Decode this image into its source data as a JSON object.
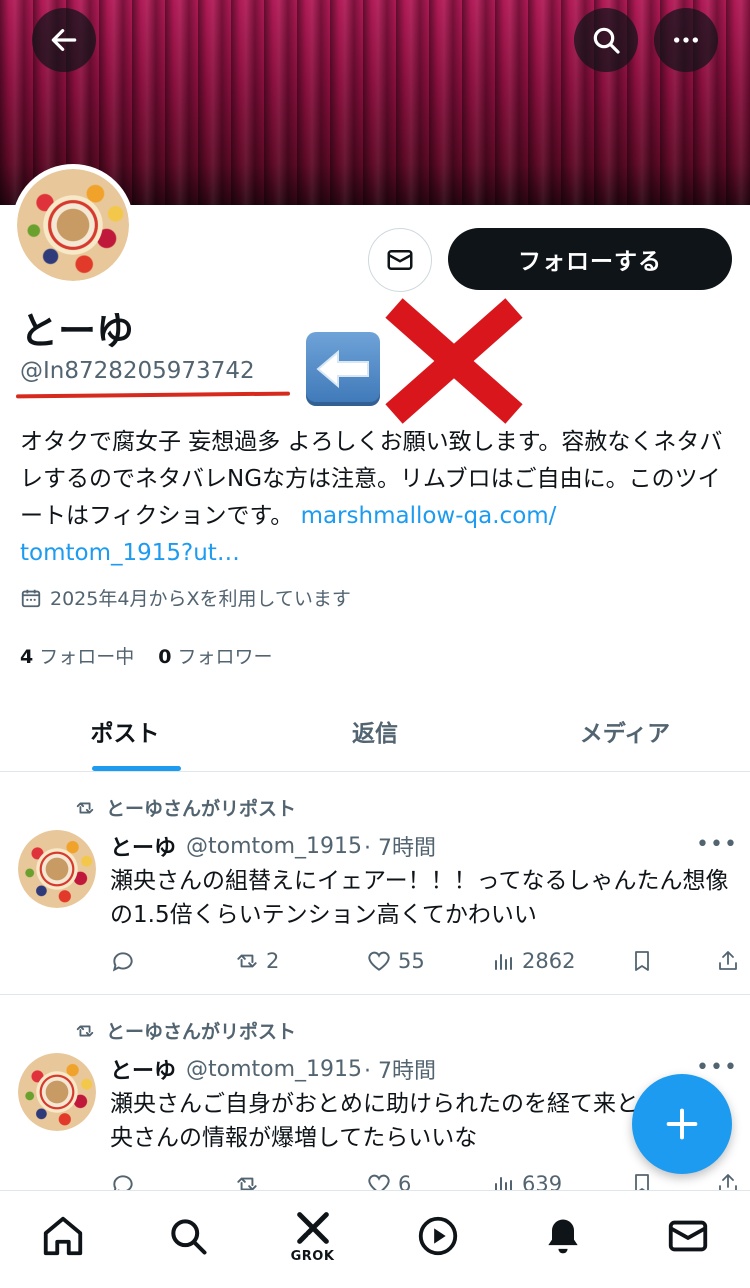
{
  "header": {
    "back_icon": "arrow-left-icon",
    "search_icon": "search-icon",
    "more_icon": "more-horizontal-icon"
  },
  "profile": {
    "name": "とーゆ",
    "handle": "@In8728205973742",
    "follow_label": "フォローする",
    "bio_text": "オタクで腐女子 妄想過多 よろしくお願い致します。容赦なくネタバレするのでネタバレNGな方は注意。リムブロはご自由に。このツイートはフィクションです。",
    "bio_link": "marshmallow-qa.com/ tomtom_1915?ut…",
    "joined": "2025年4月からXを利用しています",
    "following_count": "4",
    "following_label": "フォロー中",
    "followers_count": "0",
    "followers_label": "フォロワー"
  },
  "tabs": [
    {
      "label": "ポスト",
      "active": true
    },
    {
      "label": "返信",
      "active": false
    },
    {
      "label": "メディア",
      "active": false
    }
  ],
  "posts": [
    {
      "repost_label": "とーゆさんがリポスト",
      "author": "とーゆ",
      "handle": "@tomtom_1915",
      "time": "· 7時間",
      "more": "•••",
      "text": "瀬央さんの組替えにイェアー！！！ってなるしゃんたん想像の1.5倍くらいテンション高くてかわいい",
      "reposts": "2",
      "likes": "55",
      "views": "2862"
    },
    {
      "repost_label": "とーゆさんがリポスト",
      "author": "とーゆ",
      "handle": "@tomtom_1915",
      "time": "· 7時間",
      "more": "•••",
      "text": "瀬央さんご自身がおとめに助けられたのを経て来とめは瀬央さんの情報が爆増してたらいいな",
      "reposts": "",
      "likes": "6",
      "views": "639"
    }
  ],
  "bottom_nav": [
    {
      "icon": "home-icon"
    },
    {
      "icon": "search-icon"
    },
    {
      "icon": "grok-icon",
      "label": "GROK"
    },
    {
      "icon": "play-icon"
    },
    {
      "icon": "bell-icon"
    },
    {
      "icon": "mail-icon"
    }
  ],
  "colors": {
    "accent": "#1d9bf0",
    "text": "#0f1419",
    "secondary": "#536471",
    "annotation_red": "#d62a1f"
  }
}
